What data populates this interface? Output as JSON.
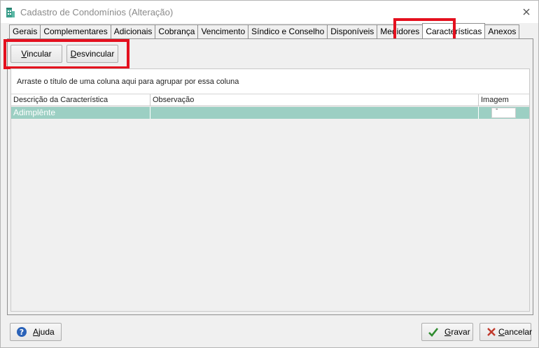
{
  "window": {
    "title": "Cadastro de Condomínios (Alteração)"
  },
  "tabs": [
    {
      "label": "Gerais"
    },
    {
      "label": "Complementares"
    },
    {
      "label": "Adicionais"
    },
    {
      "label": "Cobrança"
    },
    {
      "label": "Vencimento"
    },
    {
      "label": "Síndico e Conselho"
    },
    {
      "label": "Disponíveis"
    },
    {
      "label": "Medidores"
    },
    {
      "label": "Características"
    },
    {
      "label": "Anexos"
    }
  ],
  "actions": {
    "vincular": {
      "first": "V",
      "rest": "incular"
    },
    "desvincular": {
      "first": "D",
      "rest": "esvincular"
    }
  },
  "grid": {
    "group_hint": "Arraste o título de uma coluna aqui para agrupar por essa coluna",
    "columns": [
      "Descrição da Característica",
      "Observação",
      "Imagem"
    ],
    "rows": [
      {
        "descricao": "Adimplênte",
        "observacao": "",
        "imagem": "-"
      }
    ]
  },
  "footer": {
    "ajuda": {
      "first": "A",
      "rest": "juda"
    },
    "gravar": {
      "first": "G",
      "rest": "ravar"
    },
    "cancelar": {
      "first": "C",
      "rest": "ancelar"
    }
  },
  "colors": {
    "highlight": "#e4101e",
    "selected_row": "#9ccfc3",
    "confirm": "#2e8b2e",
    "cancel": "#c0392b",
    "help": "#2a62b8"
  }
}
